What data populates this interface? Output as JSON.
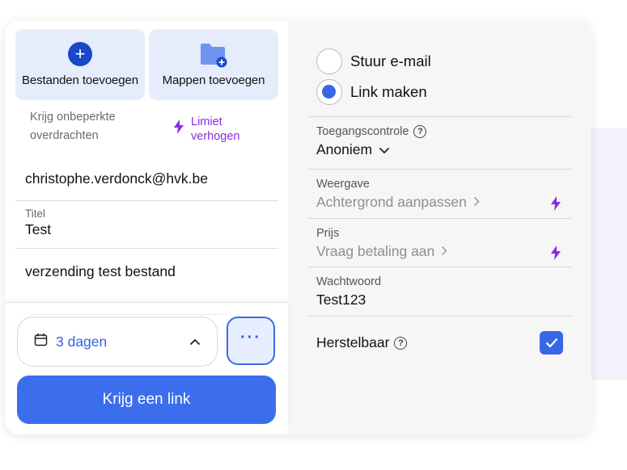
{
  "upload": {
    "add_files_label": "Bestanden toevoegen",
    "add_folders_label": "Mappen toevoegen"
  },
  "promo": {
    "text": "Krijg onbeperkte overdrachten",
    "link_label": "Limiet verhogen"
  },
  "form": {
    "email": "christophe.verdonck@hvk.be",
    "title_label": "Titel",
    "title_value": "Test",
    "message": "verzending test bestand"
  },
  "footer": {
    "expiry_value": "3 dagen",
    "more_label": "···",
    "submit_label": "Krijg een link"
  },
  "delivery": {
    "options": [
      {
        "label": "Stuur e-mail",
        "selected": false
      },
      {
        "label": "Link maken",
        "selected": true
      }
    ]
  },
  "settings": {
    "access_label": "Toegangscontrole",
    "access_value": "Anoniem",
    "view_label": "Weergave",
    "view_value": "Achtergrond aanpassen",
    "price_label": "Prijs",
    "price_value": "Vraag betaling aan",
    "password_label": "Wachtwoord",
    "password_value": "Test123",
    "restore_label": "Herstelbaar",
    "restore_checked": true
  },
  "colors": {
    "accent_blue": "#3b6ded",
    "dark_blue": "#1a47c8",
    "premium_purple": "#8a2be2",
    "tile_bg": "#e5edfd"
  }
}
